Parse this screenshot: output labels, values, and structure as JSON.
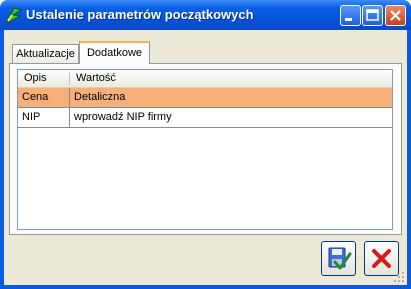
{
  "window": {
    "title": "Ustalenie parametrów początkowych"
  },
  "titlebar_buttons": [
    "minimize-icon",
    "maximize-icon",
    "close-icon"
  ],
  "tabs": [
    {
      "label": "Aktualizacje",
      "active": false
    },
    {
      "label": "Dodatkowe",
      "active": true
    }
  ],
  "grid": {
    "columns": [
      "Opis",
      "Wartość"
    ],
    "rows": [
      {
        "opis": "Cena",
        "wartosc": "Detaliczna",
        "selected": true
      },
      {
        "opis": "NIP",
        "wartosc": "wprowadź NIP firmy",
        "selected": false
      }
    ]
  },
  "buttons": {
    "ok": "save-check-icon",
    "cancel": "red-x-icon"
  },
  "colors": {
    "titlebar": "#0553d6",
    "selected_row": "#f8b07a",
    "active_tab_accent": "#f7b64a",
    "cancel_red": "#d21b1b"
  }
}
